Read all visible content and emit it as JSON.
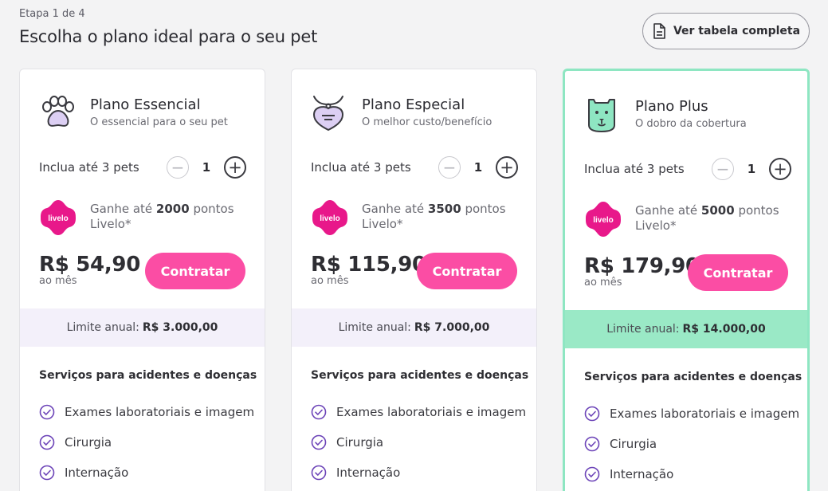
{
  "header": {
    "step": "Etapa 1 de 4",
    "title": "Escolha o plano ideal para o seu pet",
    "table_button": "Ver tabela completa"
  },
  "colors": {
    "accent_pink": "#fb4da4",
    "check_purple": "#6c44b8",
    "plus_green": "#8ee6c2",
    "limit_lavender": "#f3f0fa"
  },
  "plans": [
    {
      "name": "Plano Essencial",
      "subtitle": "O essencial para o seu pet",
      "icon": "paw-icon",
      "pets_label": "Inclua até 3 pets",
      "quantity": "1",
      "points_prefix": "Ganhe até",
      "points": "2000",
      "points_suffix": "pontos",
      "points_brand": "Livelo*",
      "price": "R$ 54,90",
      "period": "ao mês",
      "cta": "Contratar",
      "limit_label": "Limite anual:",
      "limit_value": "R$ 3.000,00",
      "services_title": "Serviços para acidentes e doenças",
      "services": [
        "Exames laboratoriais e imagem",
        "Cirurgia",
        "Internação"
      ]
    },
    {
      "name": "Plano Especial",
      "subtitle": "O melhor custo/benefício",
      "icon": "pet-tag-icon",
      "pets_label": "Inclua até 3 pets",
      "quantity": "1",
      "points_prefix": "Ganhe até",
      "points": "3500",
      "points_suffix": "pontos",
      "points_brand": "Livelo*",
      "price": "R$ 115,90",
      "period": "ao mês",
      "cta": "Contratar",
      "limit_label": "Limite anual:",
      "limit_value": "R$ 7.000,00",
      "services_title": "Serviços para acidentes e doenças",
      "services": [
        "Exames laboratoriais e imagem",
        "Cirurgia",
        "Internação"
      ]
    },
    {
      "name": "Plano Plus",
      "subtitle": "O dobro da cobertura",
      "icon": "dog-face-icon",
      "pets_label": "Inclua até 3 pets",
      "quantity": "1",
      "points_prefix": "Ganhe até",
      "points": "5000",
      "points_suffix": "pontos",
      "points_brand": "Livelo*",
      "price": "R$ 179,90",
      "period": "ao mês",
      "cta": "Contratar",
      "limit_label": "Limite anual:",
      "limit_value": "R$ 14.000,00",
      "services_title": "Serviços para acidentes e doenças",
      "services": [
        "Exames laboratoriais e imagem",
        "Cirurgia",
        "Internação"
      ]
    }
  ],
  "livelo_logo_text": "livelo"
}
